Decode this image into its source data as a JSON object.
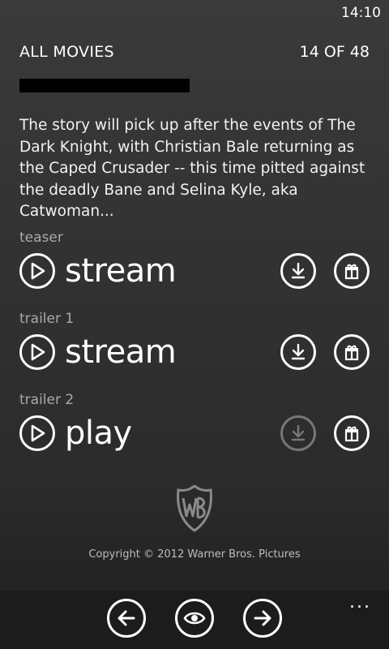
{
  "status": {
    "time": "14:10"
  },
  "header": {
    "title": "ALL MOVIES",
    "counter": "14 OF 48"
  },
  "movie": {
    "description": "The story will pick up after the events of The Dark Knight, with Christian Bale returning as the Caped Crusader -- this time pitted against the deadly Bane and Selina Kyle, aka Catwoman..."
  },
  "clips": [
    {
      "label": "teaser",
      "action": "stream",
      "download_enabled": true
    },
    {
      "label": "trailer 1",
      "action": "stream",
      "download_enabled": true
    },
    {
      "label": "trailer 2",
      "action": "play",
      "download_enabled": false
    }
  ],
  "footer": {
    "copyright": "Copyright © 2012 Warner Bros. Pictures"
  },
  "appbar": {
    "more": "..."
  },
  "icons": {
    "play": "play-icon",
    "download": "download-icon",
    "gift": "gift-icon",
    "back": "arrow-left-icon",
    "view": "eye-icon",
    "next": "arrow-right-icon",
    "logo": "wb-shield-logo"
  },
  "colors": {
    "background": "#333333",
    "foreground": "#ffffff",
    "disabled": "#777777",
    "appbar": "#1c1c1c"
  }
}
